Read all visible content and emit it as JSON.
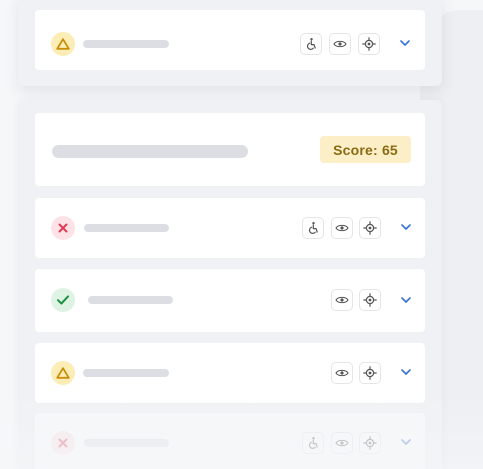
{
  "summary": {
    "score_label": "Score: 65"
  },
  "colors": {
    "warning": "#d39a12",
    "error": "#e23b53",
    "success": "#1e8f43",
    "accent": "#3b6fd8"
  },
  "rows": [
    {
      "status": "warning",
      "icons": [
        "accessibility-icon",
        "eye-icon",
        "target-icon"
      ]
    },
    {
      "status": "error",
      "icons": [
        "accessibility-icon",
        "eye-icon",
        "target-icon"
      ]
    },
    {
      "status": "success",
      "icons": [
        "eye-icon",
        "target-icon"
      ]
    },
    {
      "status": "warning",
      "icons": [
        "eye-icon",
        "target-icon"
      ]
    },
    {
      "status": "error",
      "icons": [
        "accessibility-icon",
        "eye-icon",
        "target-icon"
      ]
    }
  ]
}
